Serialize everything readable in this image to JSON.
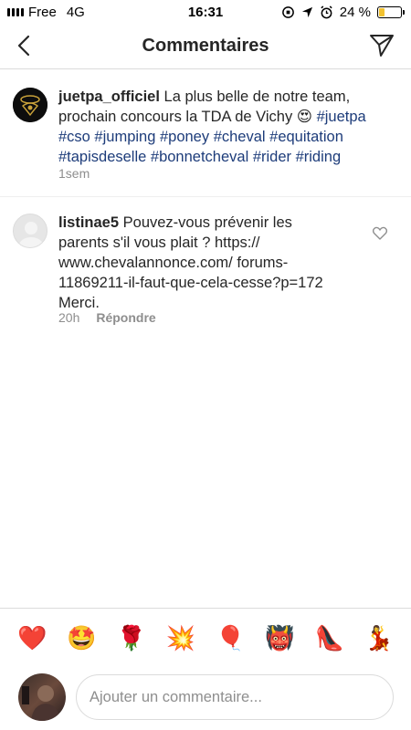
{
  "status_bar": {
    "carrier": "Free",
    "network": "4G",
    "time": "16:31",
    "battery_percent": "24 %",
    "battery_level": 0.24
  },
  "header": {
    "title": "Commentaires",
    "back_icon": "chevron-left-icon",
    "send_icon": "paper-plane-icon"
  },
  "caption": {
    "username": "juetpa_officiel",
    "text": "La plus belle de notre team, prochain concours la TDA de Vichy",
    "emoji": "😍",
    "hashtags": "#juetpa #cso #jumping #poney #cheval #equitation #tapisdeselle #bonnetcheval #rider #riding",
    "time": "1sem"
  },
  "comment": {
    "username": "listinae5",
    "text": "Pouvez-vous prévenir les parents s'il vous plait ? https:// www.chevalannonce.com/ forums-11869211-il-faut-que-cela-cesse?p=172 Merci.",
    "time": "20h",
    "reply_label": "Répondre",
    "like_icon": "heart-outline-icon"
  },
  "emoji_bar": {
    "items": [
      "❤️",
      "🤩",
      "🌹",
      "💥",
      "🎈",
      "👹",
      "👠",
      "💃"
    ]
  },
  "composer": {
    "placeholder": "Ajouter un commentaire..."
  },
  "colors": {
    "hashtag": "#1d3c7a",
    "muted": "#8e8e8e",
    "text": "#262626",
    "battery": "#f2c230"
  }
}
